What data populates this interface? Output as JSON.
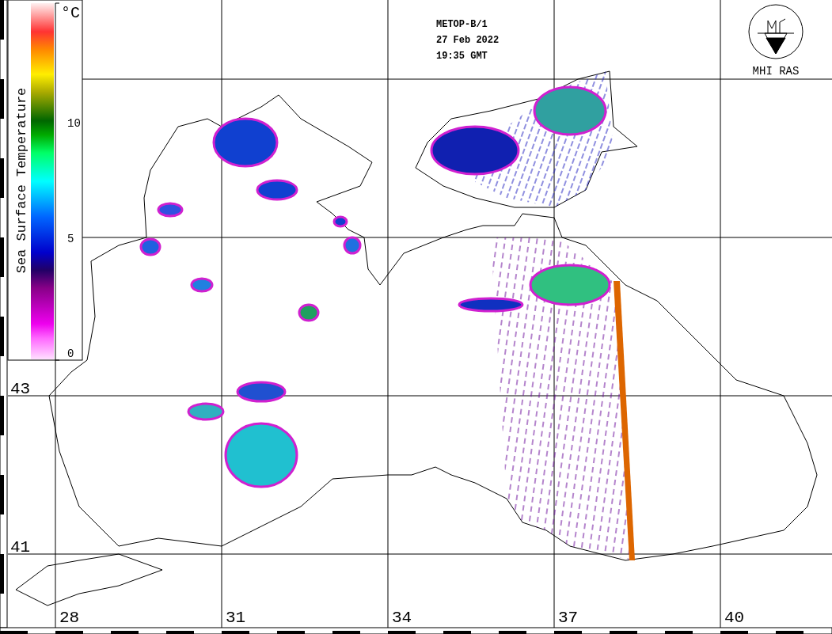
{
  "header": {
    "lines": [
      "METOP-B/1",
      "27 Feb 2022",
      "19:35 GMT"
    ]
  },
  "logo": {
    "caption": "MHI RAS"
  },
  "legend": {
    "title": "Sea Surface Temperature",
    "unit": "°C",
    "ticks": [
      "10",
      "5",
      "0"
    ]
  },
  "map": {
    "latitude_labels": [
      "43",
      "41"
    ],
    "longitude_labels": [
      "28",
      "31",
      "34",
      "37",
      "40"
    ]
  }
}
